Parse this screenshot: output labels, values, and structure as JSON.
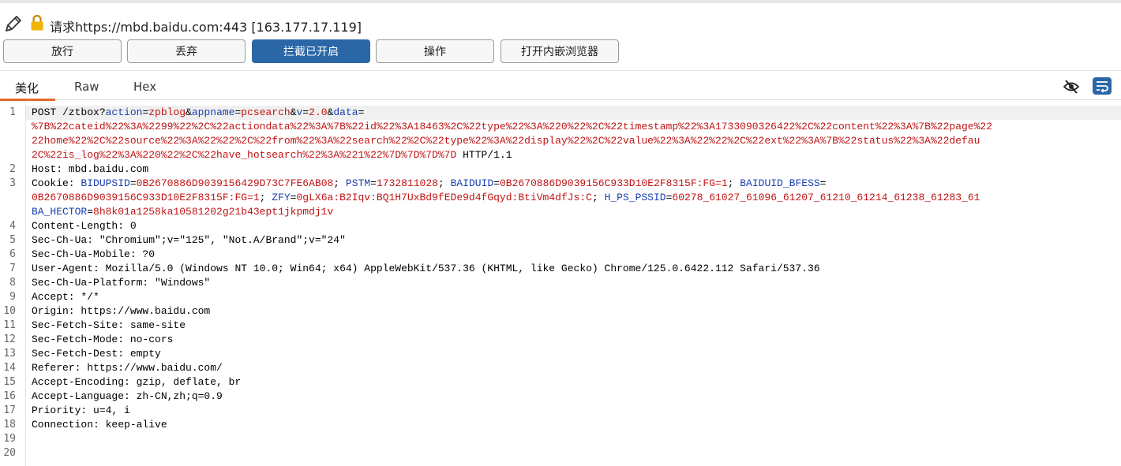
{
  "header": {
    "title": "请求https://mbd.baidu.com:443  [163.177.17.119]",
    "icons": [
      "pencil-icon",
      "lock-icon"
    ]
  },
  "toolbar": {
    "forward_label": "放行",
    "drop_label": "丢弃",
    "intercept_label": "拦截已开启",
    "action_label": "操作",
    "browser_label": "打开内嵌浏览器"
  },
  "tabs": {
    "pretty": "美化",
    "raw": "Raw",
    "hex": "Hex"
  },
  "colors": {
    "accent": "#2b67a6",
    "tab_underline": "#e56a2a",
    "param_name": "#1b3fb0",
    "param_value": "#c01414"
  },
  "request": {
    "line1": {
      "method": "POST /ztbox?",
      "p1k": "action",
      "p1v": "zpblog",
      "p2k": "appname",
      "p2v": "pcsearch",
      "p3k": "v",
      "p3v": "2.0",
      "p4k": "data",
      "eq": "=",
      "amp": "&",
      "data1": "%7B%22cateid%22%3A%2299%22%2C%22actiondata%22%3A%7B%22id%22%3A18463%2C%22type%22%3A%220%22%2C%22timestamp%22%3A1733090326422%2C%22content%22%3A%7B%22page%22",
      "data2": "22home%22%2C%22source%22%3A%22%22%2C%22from%22%3A%22search%22%2C%22type%22%3A%22display%22%2C%22value%22%3A%22%22%2C%22ext%22%3A%7B%22status%22%3A%22defau",
      "data3": "2C%22is_log%22%3A%220%22%2C%22have_hotsearch%22%3A%221%22%7D%7D%7D%7D",
      "proto": " HTTP/1.1"
    },
    "host": "Host: mbd.baidu.com",
    "cookie": {
      "label": "Cookie: ",
      "c1k": "BIDUPSID",
      "c1v": "0B2670886D9039156429D73C7FE6AB08",
      "c2k": "PSTM",
      "c2v": "1732811028",
      "c3k": "BAIDUID",
      "c3v": "0B2670886D9039156C933D10E2F8315F:FG=1",
      "c4k": "BAIDUID_BFESS",
      "c5v": "0B2670886D9039156C933D10E2F8315F:FG=1",
      "c6k": "ZFY",
      "c6v": "0gLX6a:B2Iqv:BQ1H7UxBd9fEDe9d4fGqyd:BtiVm4dfJs:C",
      "c7k": "H_PS_PSSID",
      "c7v": "60278_61027_61096_61207_61210_61214_61238_61283_61",
      "c8k": "BA_HECTOR",
      "c8v": "8h8k01a1258ka10581202g21b43ept1jkpmdj1v",
      "sep": "; "
    },
    "headers": [
      "Content-Length: 0",
      "Sec-Ch-Ua: \"Chromium\";v=\"125\", \"Not.A/Brand\";v=\"24\"",
      "Sec-Ch-Ua-Mobile: ?0",
      "User-Agent: Mozilla/5.0 (Windows NT 10.0; Win64; x64) AppleWebKit/537.36 (KHTML, like Gecko) Chrome/125.0.6422.112 Safari/537.36",
      "Sec-Ch-Ua-Platform: \"Windows\"",
      "Accept: */*",
      "Origin: https://www.baidu.com",
      "Sec-Fetch-Site: same-site",
      "Sec-Fetch-Mode: no-cors",
      "Sec-Fetch-Dest: empty",
      "Referer: https://www.baidu.com/",
      "Accept-Encoding: gzip, deflate, br",
      "Accept-Language: zh-CN,zh;q=0.9",
      "Priority: u=4, i",
      "Connection: keep-alive"
    ],
    "line_numbers": [
      "1",
      "2",
      "3",
      "4",
      "5",
      "6",
      "7",
      "8",
      "9",
      "10",
      "11",
      "12",
      "13",
      "14",
      "15",
      "16",
      "17",
      "18",
      "19",
      "20"
    ]
  }
}
